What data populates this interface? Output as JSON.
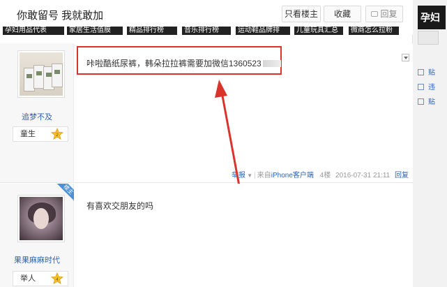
{
  "header": {
    "thread_title": "你敢留号 我就敢加",
    "only_author_label": "只看楼主",
    "favorite_label": "收藏",
    "reply_label": "回复"
  },
  "tags": [
    "孕妇用品代表",
    "家居生活值膜",
    "精品排行榜",
    "音乐排行榜",
    "运动鞋品牌排",
    "儿童玩具汇总",
    "微商怎么拉粉"
  ],
  "posts": [
    {
      "author": "追梦不及",
      "level_label": "童生",
      "level_num": "2",
      "content": "咔啦酷纸尿裤，韩朵拉拉裤需要加微信1360523",
      "meta_prefix": "举报",
      "meta_source": "来自",
      "meta_client": "iPhone客户端",
      "floor": "4楼",
      "timestamp": "2016-07-31 21:11",
      "reply_link": "回复"
    },
    {
      "author": "果果麻麻时代",
      "level_label": "举人",
      "level_num": "4",
      "badge": "楼主",
      "content": "有喜欢交朋友的吗"
    }
  ],
  "sidebar": {
    "header": "孕妇",
    "items": [
      "贴",
      "违",
      "贴"
    ]
  },
  "colors": {
    "highlight": "#d9342c",
    "link": "#2a64b5"
  }
}
